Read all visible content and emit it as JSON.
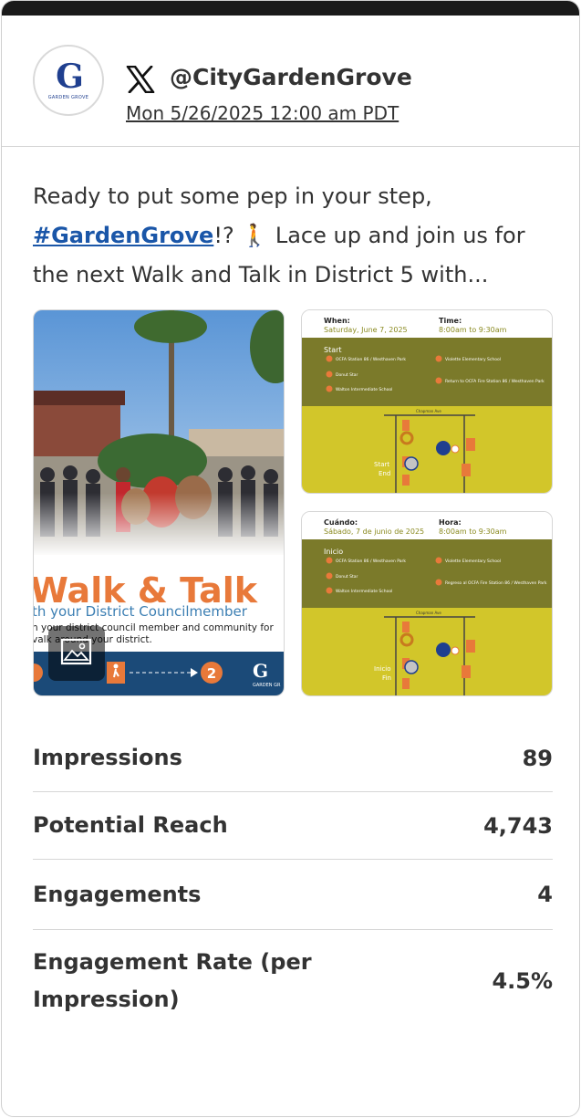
{
  "post": {
    "handle": "@CityGardenGrove",
    "timestamp": "Mon 5/26/2025 12:00 am PDT",
    "text_before": "Ready to put some pep in your step, ",
    "hashtag": "#GardenGrove",
    "text_after": "!? 🚶 Lace up and join us for the next Walk and Talk in District 5 with...",
    "avatar_logo_letter": "G",
    "avatar_logo_text": "GARDEN GROVE",
    "platform_icon": "x-logo-icon"
  },
  "media": {
    "main": {
      "title": "Walk & Talk",
      "subtitle": "th your District Councilmember",
      "body_line1": "n your district council member and community for",
      "body_line2": "valk around your district.",
      "step_number": "2",
      "brand_text": "GARDEN GR",
      "image_icon": "image-icon"
    },
    "english": {
      "when_label": "When:",
      "when_value": "Saturday, June 7, 2025",
      "time_label": "Time:",
      "time_value": "8:00am to 9:30am",
      "section": "Start",
      "stops": [
        "OCFA Station 86 / Westhaven Park",
        "Donut Star",
        "Walton Intermediate School",
        "Violette Elementary School",
        "Return to OCFA Fire Station 86 / Westhaven Park"
      ],
      "street": "Chapman Ave",
      "map_label1": "Start",
      "map_label2": "End"
    },
    "spanish": {
      "when_label": "Cuándo:",
      "when_value": "Sábado, 7 de junio de 2025",
      "time_label": "Hora:",
      "time_value": "8:00am to 9:30am",
      "section": "Inicio",
      "stops": [
        "OCFA Station 86 / Westhaven Park",
        "Donut Star",
        "Walton Intermediate School",
        "Violette Elementary School",
        "Regreso al OCFA Fire Station 86 / Westhaven Park"
      ],
      "street": "Chapman Ave",
      "map_label1": "Inicio",
      "map_label2": "Fin"
    }
  },
  "stats": [
    {
      "label": "Impressions",
      "value": "89"
    },
    {
      "label": "Potential Reach",
      "value": "4,743"
    },
    {
      "label": "Engagements",
      "value": "4"
    },
    {
      "label": "Engagement Rate (per Impression)",
      "value": "4.5%"
    }
  ],
  "colors": {
    "olive": "#7b7a2a",
    "map_yellow": "#d2c62a",
    "orange": "#e8793a",
    "navy": "#1f3f8f",
    "link_blue": "#1a56a8"
  }
}
